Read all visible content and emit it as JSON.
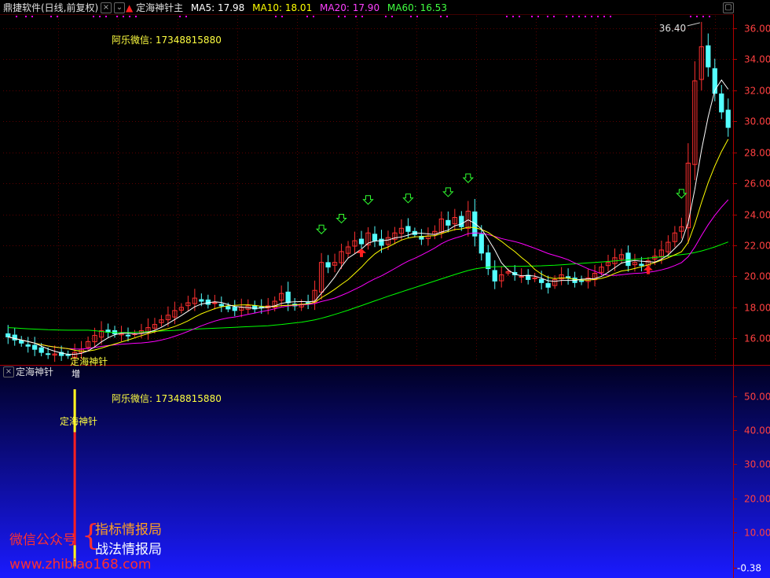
{
  "header": {
    "app_title": "鼎捷软件(日线,前复权)",
    "indicator_name": "定海神针主",
    "ma": [
      {
        "label": "MA5: 17.98",
        "color": "#ffffff"
      },
      {
        "label": "MA10: 18.01",
        "color": "#ffff00"
      },
      {
        "label": "MA20: 17.90",
        "color": "#ff00ff"
      },
      {
        "label": "MA60: 16.53",
        "color": "#00ff00"
      }
    ]
  },
  "sub_panel": {
    "title": "定海神针",
    "contact": "阿乐微信: 17348815880",
    "signal_label": "定海神针",
    "yticks": [
      "50.00",
      "40.00",
      "30.00",
      "20.00",
      "10.00",
      "-0.38"
    ]
  },
  "watermark": {
    "wechat_label": "微信公众号",
    "brace": "{",
    "line1": "指标情报局",
    "line2": "战法情报局",
    "url": "www.zhibiao168.com"
  },
  "chart_data": {
    "type": "candlestick",
    "contact_text": "阿乐微信: 17348815880",
    "price_axis": {
      "min": 14.6,
      "max": 36.8,
      "ticks": [
        "16.00",
        "18.00",
        "20.00",
        "22.00",
        "24.00",
        "26.00",
        "28.00",
        "30.00",
        "32.00",
        "34.00",
        "36.00"
      ]
    },
    "high_label": "36.40",
    "signal_text": "定海神针",
    "signal_marker": "增",
    "colors": {
      "up": "#ff3030",
      "down": "#54ffff",
      "ma5": "#ffffff",
      "ma10": "#ffff00",
      "ma20": "#ff00ff",
      "ma60": "#00ff00"
    },
    "closes": [
      16.1,
      15.9,
      15.7,
      15.5,
      15.3,
      15.1,
      15.0,
      15.0,
      14.9,
      14.9,
      15.1,
      15.3,
      15.8,
      16.2,
      16.5,
      16.4,
      16.3,
      16.3,
      16.2,
      16.3,
      16.5,
      16.7,
      16.9,
      17.2,
      17.5,
      17.8,
      18.0,
      18.3,
      18.6,
      18.4,
      18.2,
      18.3,
      18.1,
      17.9,
      17.8,
      18.0,
      18.1,
      17.9,
      18.0,
      18.1,
      18.4,
      18.9,
      18.3,
      18.1,
      18.2,
      18.3,
      19.1,
      20.9,
      20.6,
      20.9,
      21.6,
      21.9,
      22.3,
      22.1,
      22.8,
      22.3,
      22.0,
      22.5,
      22.8,
      23.1,
      22.9,
      22.7,
      22.4,
      22.6,
      22.9,
      23.7,
      23.3,
      23.8,
      23.2,
      24.2,
      22.6,
      21.5,
      20.5,
      19.7,
      20.1,
      20.3,
      20.1,
      20.0,
      19.8,
      19.9,
      19.6,
      19.3,
      19.8,
      20.1,
      19.9,
      19.6,
      19.7,
      19.9,
      20.2,
      20.6,
      20.9,
      21.2,
      21.4,
      20.7,
      20.9,
      20.7,
      21.0,
      21.3,
      21.7,
      22.2,
      22.8,
      23.2,
      27.3,
      32.6,
      34.8,
      33.5,
      31.8,
      30.6,
      29.6
    ],
    "ma60": [
      16.7,
      16.68,
      16.65,
      16.62,
      16.6,
      16.58,
      16.56,
      16.55,
      16.54,
      16.53,
      16.53,
      16.53,
      16.53,
      16.5,
      16.45,
      16.4,
      16.38,
      16.38,
      16.38,
      16.4,
      16.42,
      16.44,
      16.46,
      16.48,
      16.5,
      16.52,
      16.55,
      16.57,
      16.6,
      16.62,
      16.64,
      16.66,
      16.68,
      16.7,
      16.72,
      16.74,
      16.76,
      16.78,
      16.8,
      16.82,
      16.86,
      16.9,
      16.95,
      17.0,
      17.05,
      17.12,
      17.2,
      17.3,
      17.42,
      17.55,
      17.68,
      17.82,
      17.97,
      18.12,
      18.27,
      18.42,
      18.57,
      18.72,
      18.86,
      19.0,
      19.14,
      19.28,
      19.42,
      19.56,
      19.7,
      19.84,
      19.98,
      20.12,
      20.25,
      20.38,
      20.48,
      20.55,
      20.6,
      20.62,
      20.63,
      20.64,
      20.65,
      20.65,
      20.66,
      20.67,
      20.68,
      20.7,
      20.72,
      20.75,
      20.78,
      20.81,
      20.84,
      20.87,
      20.9,
      20.93,
      20.96,
      21.0,
      21.03,
      21.06,
      21.1,
      21.14,
      21.18,
      21.22,
      21.26,
      21.3,
      21.35,
      21.4,
      21.46,
      21.54,
      21.64,
      21.76,
      21.9,
      22.06,
      22.22
    ],
    "sub_axis": {
      "min": -0.38,
      "max": 55.0
    },
    "signal": {
      "index": 10,
      "value": 52.0
    }
  }
}
